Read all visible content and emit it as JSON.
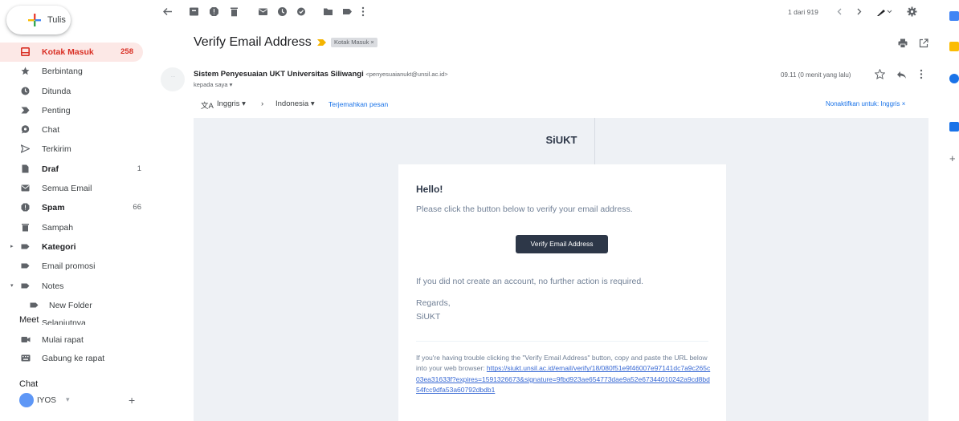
{
  "compose": {
    "label": "Tulis"
  },
  "nav": [
    {
      "label": "Kotak Masuk",
      "count": "258",
      "icon": "inbox-icon",
      "active": true
    },
    {
      "label": "Berbintang",
      "count": "",
      "icon": "star-icon"
    },
    {
      "label": "Ditunda",
      "count": "",
      "icon": "clock-icon"
    },
    {
      "label": "Penting",
      "count": "",
      "icon": "important-icon"
    },
    {
      "label": "Chat",
      "count": "",
      "icon": "chat-icon"
    },
    {
      "label": "Terkirim",
      "count": "",
      "icon": "send-icon"
    },
    {
      "label": "Draf",
      "count": "1",
      "icon": "draft-icon",
      "bold": true
    },
    {
      "label": "Semua Email",
      "count": "",
      "icon": "all-mail-icon"
    },
    {
      "label": "Spam",
      "count": "66",
      "icon": "spam-icon",
      "bold": true
    },
    {
      "label": "Sampah",
      "count": "",
      "icon": "trash-icon"
    },
    {
      "label": "Kategori",
      "count": "",
      "icon": "label-icon",
      "bold": true
    },
    {
      "label": "Email promosi",
      "count": "",
      "icon": "label-icon"
    },
    {
      "label": "Notes",
      "count": "",
      "icon": "label-icon"
    },
    {
      "label": "New Folder",
      "count": "",
      "icon": "label-icon"
    },
    {
      "label": "Selanjutnya",
      "count": "",
      "icon": "label-icon"
    }
  ],
  "meet": {
    "title": "Meet",
    "items": [
      {
        "label": "Mulai rapat",
        "icon": "video-icon"
      },
      {
        "label": "Gabung ke rapat",
        "icon": "keyboard-icon"
      }
    ]
  },
  "chat": {
    "title": "Chat",
    "user": "IYOS"
  },
  "toolbar": {
    "pagination": "1 dari 919"
  },
  "email": {
    "subject": "Verify Email Address",
    "label_chip": "Kotak Masuk ×",
    "sender_name": "Sistem Penyesuaian UKT Universitas Siliwangi",
    "sender_email": "<penyesuaianukt@unsil.ac.id>",
    "to": "kepada saya ▾",
    "time": "09.11 (0 menit yang lalu)",
    "avatar_text": "..."
  },
  "translate": {
    "from": "Inggris",
    "to": "Indonesia",
    "action": "Terjemahkan pesan",
    "disable": "Nonaktifkan untuk: Inggris ×"
  },
  "body": {
    "brand": "SiUKT",
    "hello": "Hello!",
    "line1": "Please click the button below to verify your email address.",
    "button": "Verify Email Address",
    "line2": "If you did not create an account, no further action is required.",
    "regards": "Regards,",
    "sign": "SiUKT",
    "trouble": "If you're having trouble clicking the \"Verify Email Address\" button, copy and paste the URL below into your web browser:",
    "url": "https://siukt.unsil.ac.id/email/verify/18/080f51e9f46007e97141dc7a9c265c03ea31633f?expires=1591326673&signature=9fbd923ae654773dae9a52e67344010242a9cd8bd54fcc9dfa53a60792dbdb1"
  },
  "colors": {
    "accent": "#d93025",
    "active_bg": "#fce8e6",
    "button": "#2d3748",
    "link": "#1a73e8",
    "mail_bg": "#eef1f5"
  }
}
